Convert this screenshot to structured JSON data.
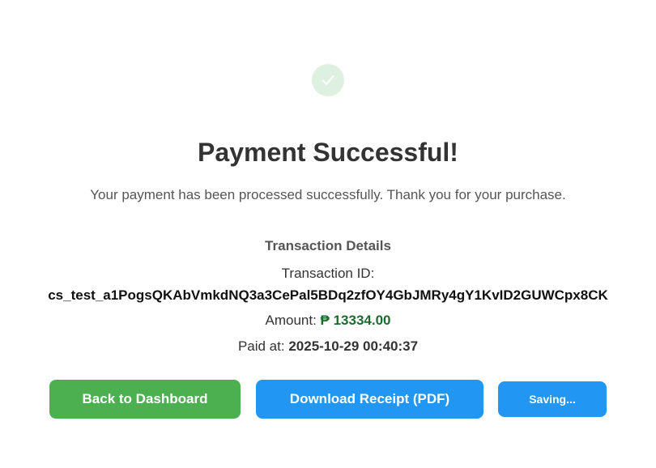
{
  "colors": {
    "success_icon_bg": "#d9efdc",
    "check": "#ffffff",
    "title": "#333333",
    "amount": "#1a6b2e",
    "back_button": "#4caf50",
    "primary_button": "#2196f3"
  },
  "success_icon": "check-icon",
  "header": {
    "title": "Payment Successful!",
    "subtitle": "Your payment has been processed successfully. Thank you for your purchase."
  },
  "details": {
    "heading": "Transaction Details",
    "transaction_id_label": "Transaction ID:",
    "transaction_id": "cs_test_a1PogsQKAbVmkdNQ3a3CePal5BDq2zfOY4GbJMRy4gY1KvID2GUWCpx8CK",
    "amount_label": "Amount:",
    "amount_value": "₱ 13334.00",
    "paid_at_label": "Paid at:",
    "paid_at_value": "2025-10-29 00:40:37"
  },
  "actions": {
    "back_label": "Back to Dashboard",
    "download_label": "Download Receipt (PDF)",
    "saving_label": "Saving..."
  }
}
